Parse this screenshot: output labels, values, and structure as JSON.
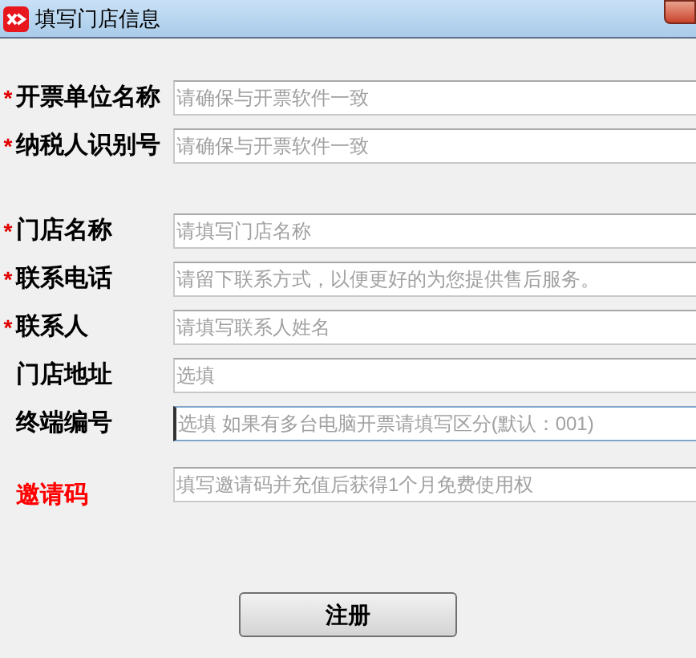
{
  "window": {
    "title": "填写门店信息"
  },
  "groups": [
    {
      "fields": [
        {
          "label": "开票单位名称",
          "required_mark": "*",
          "emphasized": false,
          "placeholder": "请确保与开票软件一致",
          "focused": false
        },
        {
          "label": "纳税人识别号",
          "required_mark": "*",
          "emphasized": false,
          "placeholder": "请确保与开票软件一致",
          "focused": false
        }
      ]
    },
    {
      "fields": [
        {
          "label": "门店名称",
          "required_mark": "*",
          "emphasized": false,
          "placeholder": "请填写门店名称",
          "focused": false
        },
        {
          "label": "联系电话",
          "required_mark": "*",
          "emphasized": false,
          "placeholder": "请留下联系方式，以便更好的为您提供售后服务。",
          "focused": false
        },
        {
          "label": "联系人",
          "required_mark": "*",
          "emphasized": false,
          "placeholder": "请填写联系人姓名",
          "focused": false
        },
        {
          "label": "门店地址",
          "emphasized": false,
          "placeholder": "选填",
          "focused": false
        },
        {
          "label": "终端编号",
          "emphasized": false,
          "placeholder": "选填 如果有多台电脑开票请填写区分(默认：001)",
          "focused": true
        }
      ]
    },
    {
      "fields": [
        {
          "label": "邀请码",
          "emphasized": true,
          "placeholder": "填写邀请码并充值后获得1个月免费使用权",
          "focused": false
        }
      ]
    }
  ],
  "buttons": [
    "注册"
  ]
}
